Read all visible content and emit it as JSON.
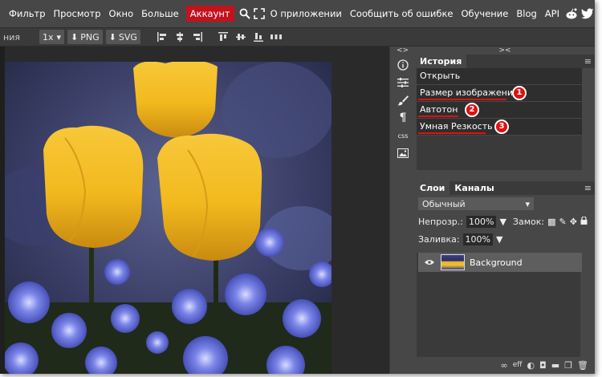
{
  "menu": {
    "items": [
      "Фильтр",
      "Просмотр",
      "Окно",
      "Больше"
    ],
    "account": "Аккаунт",
    "right_items": [
      "О приложении",
      "Сообщить об ошибке",
      "Обучение",
      "Blog",
      "API"
    ],
    "icons": [
      "search-icon",
      "fullscreen-icon",
      "reddit-icon",
      "twitter-icon",
      "facebook-icon"
    ]
  },
  "toolbar": {
    "partial_label": "ния",
    "zoom": "1x",
    "png_label": "PNG",
    "svg_label": "SVG",
    "align_icons": [
      "align-left-icon",
      "align-center-icon",
      "align-right-icon",
      "align-top-icon",
      "align-middle-icon",
      "align-bottom-icon",
      "distribute-icon"
    ]
  },
  "toolcolumn": {
    "toggle": "<>",
    "buttons": [
      "info-icon",
      "adjustments-icon",
      "brush-icon",
      "paragraph-icon",
      "css-icon",
      "image-icon"
    ],
    "css_label": "css"
  },
  "history": {
    "toggle": "><",
    "tab": "История",
    "menu": "≡",
    "rows": [
      {
        "label": "Открыть"
      },
      {
        "label": "Размер изображения",
        "marker": "1"
      },
      {
        "label": "Автотон",
        "marker": "2"
      },
      {
        "label": "Умная Резкость",
        "marker": "3"
      }
    ]
  },
  "layers": {
    "tabs": [
      "Слои",
      "Каналы"
    ],
    "menu": "≡",
    "blend_mode": "Обычный",
    "opacity_label": "Непрозр.:",
    "opacity_value": "100%",
    "lock_label": "Замок:",
    "fill_label": "Заливка:",
    "fill_value": "100%",
    "layer_name": "Background",
    "footer_icons": [
      "link-icon",
      "effects-icon",
      "adjustment-layer-icon",
      "mask-icon",
      "folder-icon",
      "new-layer-icon",
      "trash-icon"
    ],
    "footer_effects_label": "eff"
  },
  "colors": {
    "accent": "#c2121e",
    "annotation_red": "#dd1111"
  }
}
